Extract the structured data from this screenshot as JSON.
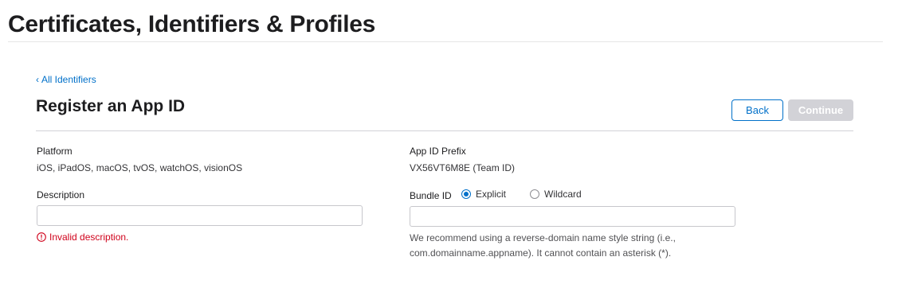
{
  "header": {
    "title": "Certificates, Identifiers & Profiles"
  },
  "nav": {
    "back_link_chevron": "‹",
    "back_link_label": "All Identifiers"
  },
  "form": {
    "title": "Register an App ID",
    "back_button": "Back",
    "continue_button": "Continue",
    "platform": {
      "label": "Platform",
      "value": "iOS, iPadOS, macOS, tvOS, watchOS, visionOS"
    },
    "app_id_prefix": {
      "label": "App ID Prefix",
      "value": "VX56VT6M8E (Team ID)"
    },
    "description": {
      "label": "Description",
      "value": "",
      "error": "Invalid description."
    },
    "bundle_id": {
      "label": "Bundle ID",
      "options": [
        {
          "label": "Explicit",
          "selected": true
        },
        {
          "label": "Wildcard",
          "selected": false
        }
      ],
      "value": "",
      "help": "We recommend using a reverse-domain name style string (i.e., com.domainname.appname). It cannot contain an asterisk (*)."
    }
  },
  "colors": {
    "link": "#0070c9",
    "error": "#d0021b",
    "disabled_button": "#d2d2d7"
  },
  "icons": {
    "error": "error-circle-icon",
    "back": "chevron-left-icon"
  }
}
